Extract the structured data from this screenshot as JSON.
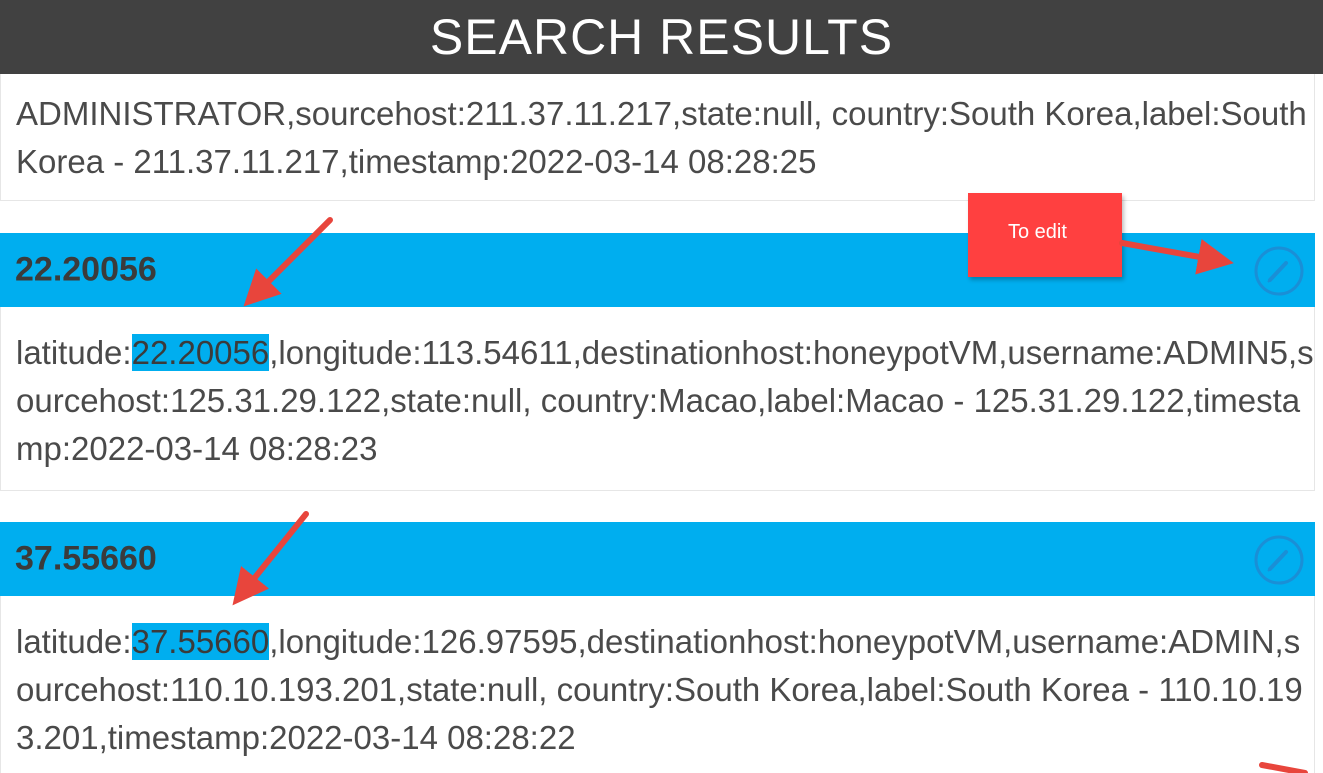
{
  "header": {
    "title": "SEARCH RESULTS"
  },
  "cards": [
    {
      "body_text": "ADMINISTRATOR,sourcehost:211.37.11.217,state:null, country:South Korea,label:South Korea - 211.37.11.217,timestamp:2022-03-14 08:28:25"
    },
    {
      "title": "22.20056",
      "body_prefix": "latitude:",
      "body_highlight": "22.20056",
      "body_rest": ",longitude:113.54611,destinationhost:honeypotVM,username:ADMIN5,sourcehost:125.31.29.122,state:null, country:Macao,label:Macao - 125.31.29.122,timestamp:2022-03-14 08:28:23"
    },
    {
      "title": "37.55660",
      "body_prefix": "latitude:",
      "body_highlight": "37.55660",
      "body_rest": ",longitude:126.97595,destinationhost:honeypotVM,username:ADMIN,sourcehost:110.10.193.201,state:null, country:South Korea,label:South Korea - 110.10.193.201,timestamp:2022-03-14 08:28:22"
    }
  ],
  "annotation": {
    "callout_text": "To edit"
  },
  "colors": {
    "header_bg": "#414141",
    "card_header_bg": "#00aeef",
    "highlight": "#00aeef",
    "annotation_red": "#ff4040",
    "arrow_red": "#e8453c"
  },
  "icons": {
    "edit": "pencil-circle-icon"
  }
}
